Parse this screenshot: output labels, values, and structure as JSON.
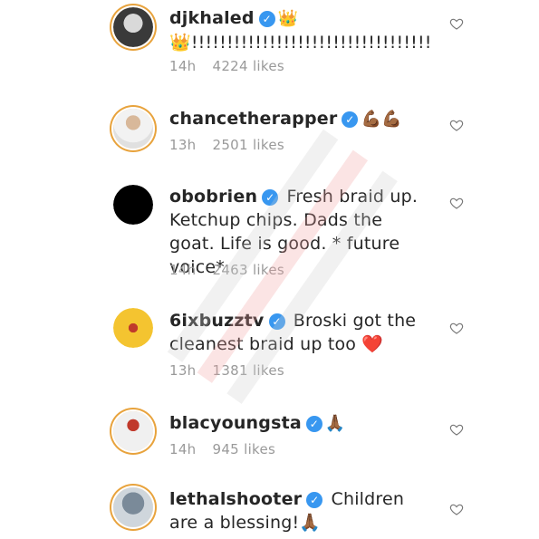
{
  "comments": [
    {
      "username": "djkhaled",
      "text": "👑!!!!!!!!!!!!!!!!!!!!!!!!!!!!!!!!!!",
      "badge_emoji": "👑",
      "time": "14h",
      "likes": "4224 likes"
    },
    {
      "username": "chancetherapper",
      "text": "",
      "badge_emoji": "💪🏾💪🏾",
      "time": "13h",
      "likes": "2501 likes"
    },
    {
      "username": "obobrien",
      "text": "Fresh braid up. Ketchup chips. Dads the goat. Life is good. * future voice*",
      "badge_emoji": "",
      "time": "14h",
      "likes": "2463 likes"
    },
    {
      "username": "6ixbuzztv",
      "text": "Broski got the cleanest braid up too ❤️",
      "badge_emoji": "",
      "time": "13h",
      "likes": "1381 likes"
    },
    {
      "username": "blacyoungsta",
      "text": "",
      "badge_emoji": "🙏🏾",
      "time": "14h",
      "likes": "945 likes"
    },
    {
      "username": "lethalshooter",
      "text": "Children are a blessing!🙏🏾",
      "badge_emoji": "",
      "time": "",
      "likes": ""
    }
  ],
  "icons": {
    "verified": "verified-check-icon",
    "like": "heart-outline-icon"
  },
  "colors": {
    "verified": "#3897f0",
    "ring": "#e8a33d",
    "meta": "#9a9a9a"
  }
}
